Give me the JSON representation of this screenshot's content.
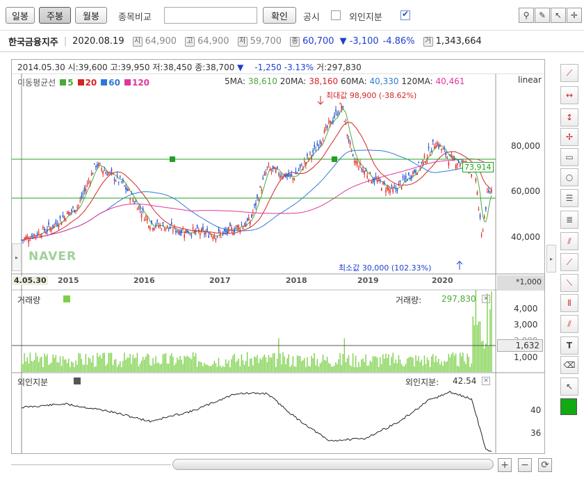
{
  "toolbar": {
    "tabs": [
      "일봉",
      "주봉",
      "월봉"
    ],
    "active_tab": "주봉",
    "compare_label": "종목비교",
    "compare_value": "",
    "confirm_label": "확인",
    "notice_label": "공시",
    "foreign_label": "외인지분",
    "notice_checked": false,
    "foreign_checked": true
  },
  "stock": {
    "name": "한국금융지주",
    "date": "2020.08.19",
    "open_badge": "시",
    "open": "64,900",
    "high_badge": "고",
    "high": "64,900",
    "low_badge": "저",
    "low": "59,700",
    "close_badge": "종",
    "close": "60,700",
    "change": "▼ -3,100",
    "change_pct": "-4.86%",
    "volume_badge": "거",
    "volume": "1,343,664"
  },
  "cursor_info": {
    "date": "2014.05.30",
    "open": "시:39,600",
    "high": "고:39,950",
    "low": "저:38,450",
    "close": "종:38,700",
    "arrow": "▼",
    "change": "-1,250",
    "change_pct": "-3.13%",
    "volume": "거:297,830"
  },
  "ma": {
    "label": "이동평균선",
    "periods": [
      "5",
      "20",
      "60",
      "120"
    ],
    "colors": [
      "#4aa83a",
      "#d42424",
      "#2f79d6",
      "#e0359a"
    ],
    "values_text": [
      "5MA:",
      "38,610",
      "20MA:",
      "38,160",
      "60MA:",
      "40,330",
      "120MA:",
      "40,461"
    ]
  },
  "scale_label": "linear",
  "price_axis": [
    "80,000",
    "60,000",
    "40,000"
  ],
  "year_labels": [
    "4.05.30",
    "2015",
    "2016",
    "2017",
    "2018",
    "2019",
    "2020"
  ],
  "max_label": "최대값 98,900 (-38.62%)",
  "min_label": "최소값 30,000 (102.33%)",
  "hline_value": "73,914",
  "watermark": "NAVER",
  "volume_panel": {
    "title": "거래량",
    "value_label": "거래량:",
    "value": "297,830",
    "unit": "*1,000",
    "axis": [
      "4,000",
      "3,000",
      "2,000",
      "1,000"
    ],
    "marker": "1,632"
  },
  "foreign_panel": {
    "title": "외인지분",
    "value_label": "외인지분:",
    "value": "42.54",
    "axis": [
      "40",
      "36"
    ]
  },
  "colors": {
    "up": "#e0302a",
    "down": "#2657d0",
    "volume": "#7cd049",
    "hline": "#22a022",
    "accent_blue": "#1b3fd1"
  }
}
